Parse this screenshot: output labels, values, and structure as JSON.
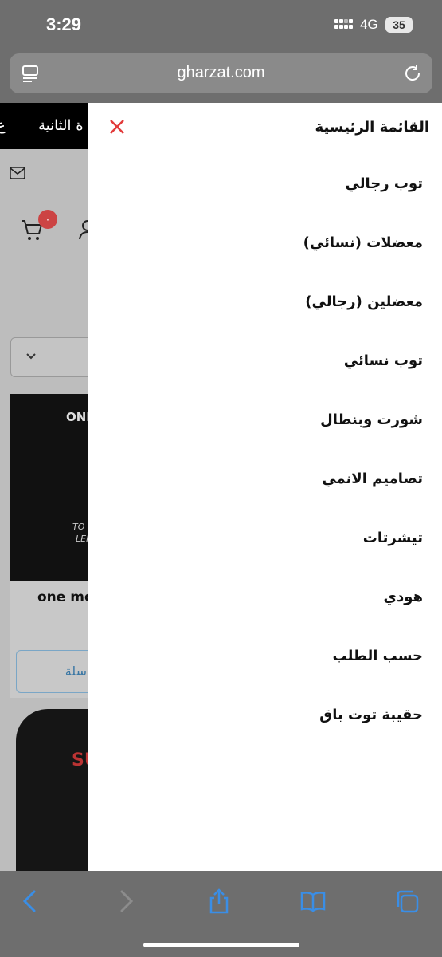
{
  "status_bar": {
    "time": "3:29",
    "network": "4G",
    "battery": "35"
  },
  "browser": {
    "url": "gharzat.com"
  },
  "background_page": {
    "topbar_text_left": "ع",
    "topbar_text": "ة الثانية",
    "cart_badge": "٠",
    "product1_print_top": "ONE",
    "product1_print_mid": "TO",
    "product1_print_bottom": "LEFT",
    "product1_title": "one mo",
    "product1_button": "سلة",
    "product2_print": "SU"
  },
  "drawer": {
    "title": "القائمة الرئيسية",
    "items": [
      {
        "label": "توب رجالي"
      },
      {
        "label": "معضلات (نسائي)"
      },
      {
        "label": "معضلين (رجالي)"
      },
      {
        "label": "توب نسائي"
      },
      {
        "label": "شورت وبنطال"
      },
      {
        "label": "تصاميم الانمي"
      },
      {
        "label": "تيشرتات"
      },
      {
        "label": "هودي"
      },
      {
        "label": "حسب الطلب"
      },
      {
        "label": "حقيبة توت باق"
      }
    ]
  },
  "colors": {
    "close_icon": "#e23b3b",
    "toolbar_icons": "#3a8ee6",
    "badge": "#c44444"
  },
  "icons": {
    "tabs": "tabs-icon",
    "reload": "reload-icon",
    "close": "close-icon",
    "back": "back-icon",
    "forward": "forward-icon",
    "share": "share-icon",
    "bookmarks": "bookmarks-icon",
    "tab_switcher": "tab-switcher-icon"
  }
}
